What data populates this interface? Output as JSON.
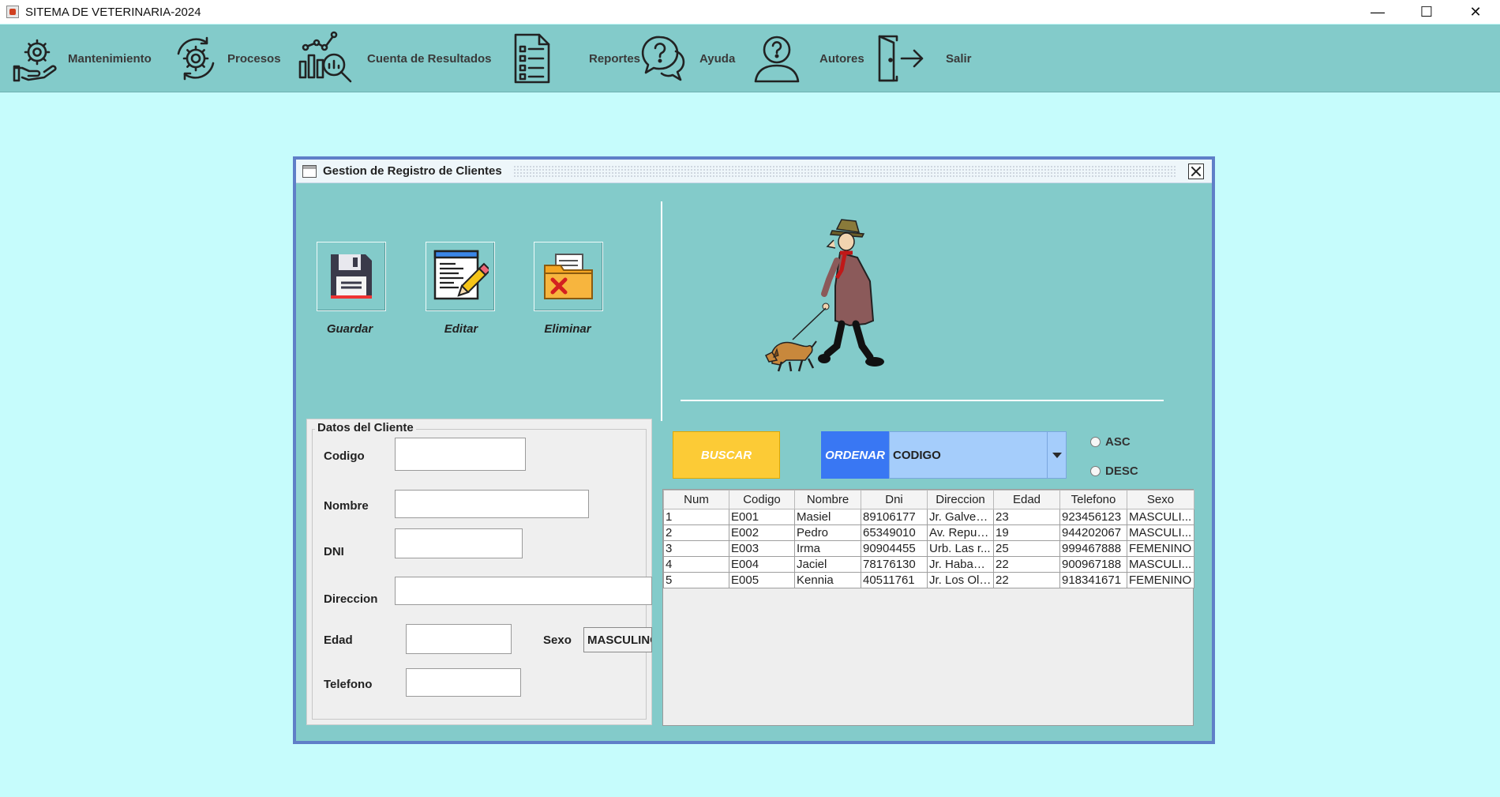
{
  "window": {
    "title": "SITEMA DE VETERINARIA-2024"
  },
  "menu": [
    {
      "label": "Mantenimiento",
      "icon": "hand-gear-icon"
    },
    {
      "label": "Procesos",
      "icon": "process-gear-icon"
    },
    {
      "label": "Cuenta de Resultados",
      "icon": "chart-magnifier-icon"
    },
    {
      "label": "Reportes",
      "icon": "report-list-icon"
    },
    {
      "label": "Ayuda",
      "icon": "help-chat-icon"
    },
    {
      "label": "Autores",
      "icon": "user-question-icon"
    },
    {
      "label": "Salir",
      "icon": "exit-door-icon"
    }
  ],
  "form": {
    "title": "Gestion de Registro de Clientes",
    "actions": {
      "guardar": "Guardar",
      "editar": "Editar",
      "eliminar": "Eliminar"
    },
    "datos": {
      "legend": "Datos del Cliente",
      "codigo_label": "Codigo",
      "nombre_label": "Nombre",
      "dni_label": "DNI",
      "direccion_label": "Direccion",
      "edad_label": "Edad",
      "sexo_label": "Sexo",
      "sexo_value": "MASCULINO",
      "telefono_label": "Telefono"
    },
    "buscar": "BUSCAR",
    "ordenar": "ORDENAR",
    "orden_value": "CODIGO",
    "asc": "ASC",
    "desc": "DESC"
  },
  "table": {
    "columns": [
      "Num",
      "Codigo",
      "Nombre",
      "Dni",
      "Direccion",
      "Edad",
      "Telefono",
      "Sexo"
    ],
    "rows": [
      [
        "1",
        "E001",
        "Masiel",
        "89106177",
        "Jr. Galves ...",
        "23",
        "923456123",
        "MASCULI..."
      ],
      [
        "2",
        "E002",
        "Pedro",
        "65349010",
        "Av. Republ...",
        "19",
        "944202067",
        "MASCULI..."
      ],
      [
        "3",
        "E003",
        "Irma",
        "90904455",
        "Urb. Las r...",
        "25",
        "999467888",
        "FEMENINO"
      ],
      [
        "4",
        "E004",
        "Jaciel",
        "78176130",
        "Jr. Habana...",
        "22",
        "900967188",
        "MASCULI..."
      ],
      [
        "5",
        "E005",
        "Kennia",
        "40511761",
        "Jr. Los Oli...",
        "22",
        "918341671",
        "FEMENINO"
      ]
    ]
  }
}
